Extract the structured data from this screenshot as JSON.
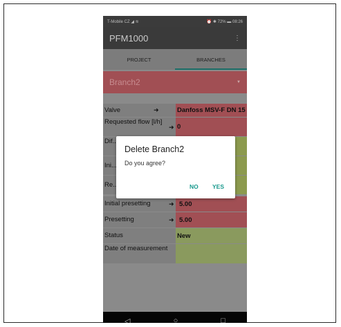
{
  "status_bar": {
    "carrier": "T-Mobile CZ",
    "battery": "72%",
    "time": "08:26"
  },
  "app_bar": {
    "title": "PFM1000",
    "menu_icon": "more-vert-icon"
  },
  "tabs": [
    {
      "label": "PROJECT"
    },
    {
      "label": "BRANCHES"
    }
  ],
  "branch_selector": {
    "value": "Branch2"
  },
  "rows": [
    {
      "label": "Valve",
      "value": "Danfoss MSV-F  DN 15",
      "color": "red"
    },
    {
      "label": "Requested flow [l/h]",
      "value": "0",
      "color": "red"
    },
    {
      "label": "Dif... [kPa]",
      "value": "",
      "color": "green"
    },
    {
      "label": "Ini...",
      "value": "",
      "color": "green"
    },
    {
      "label": "Re...",
      "value": "",
      "color": "green"
    },
    {
      "label": "Initial presetting",
      "value": "5.00",
      "color": "red"
    },
    {
      "label": "Presetting",
      "value": "5.00",
      "color": "red"
    },
    {
      "label": "Status",
      "value": "New",
      "color": "lgreen"
    },
    {
      "label": "Date of measurement",
      "value": "",
      "color": "lgreen"
    }
  ],
  "dialog": {
    "title": "Delete Branch2",
    "message": "Do you agree?",
    "no_label": "NO",
    "yes_label": "YES"
  },
  "colors": {
    "accent": "#1a9a8e",
    "red_cell": "#a14f54",
    "green_cell": "#8c9a4e"
  }
}
